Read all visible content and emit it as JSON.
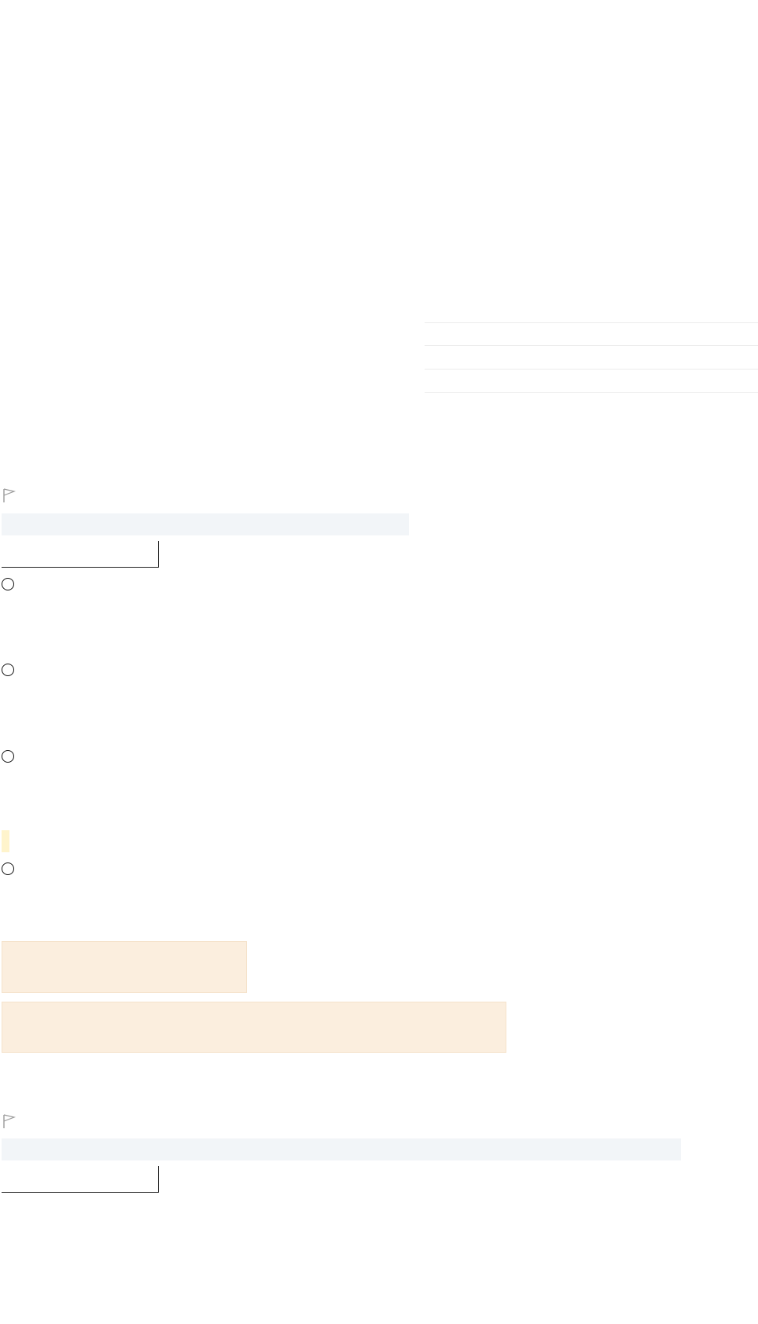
{
  "table_stub": {
    "rows": [
      "",
      "",
      ""
    ]
  },
  "question1": {
    "flag_icon": "flag-outline-icon",
    "prompt": "",
    "answer_value": "",
    "answer_placeholder": "",
    "options": [
      {
        "label": ""
      },
      {
        "label": ""
      },
      {
        "label": ""
      },
      {
        "label": ""
      }
    ],
    "feedback": [
      "",
      ""
    ]
  },
  "question2": {
    "flag_icon": "flag-outline-icon",
    "prompt": "",
    "answer_value": "",
    "answer_placeholder": ""
  },
  "colors": {
    "question_bar": "#f2f5f8",
    "feedback_bg": "#fbeede",
    "highlight": "#fff4cc"
  }
}
